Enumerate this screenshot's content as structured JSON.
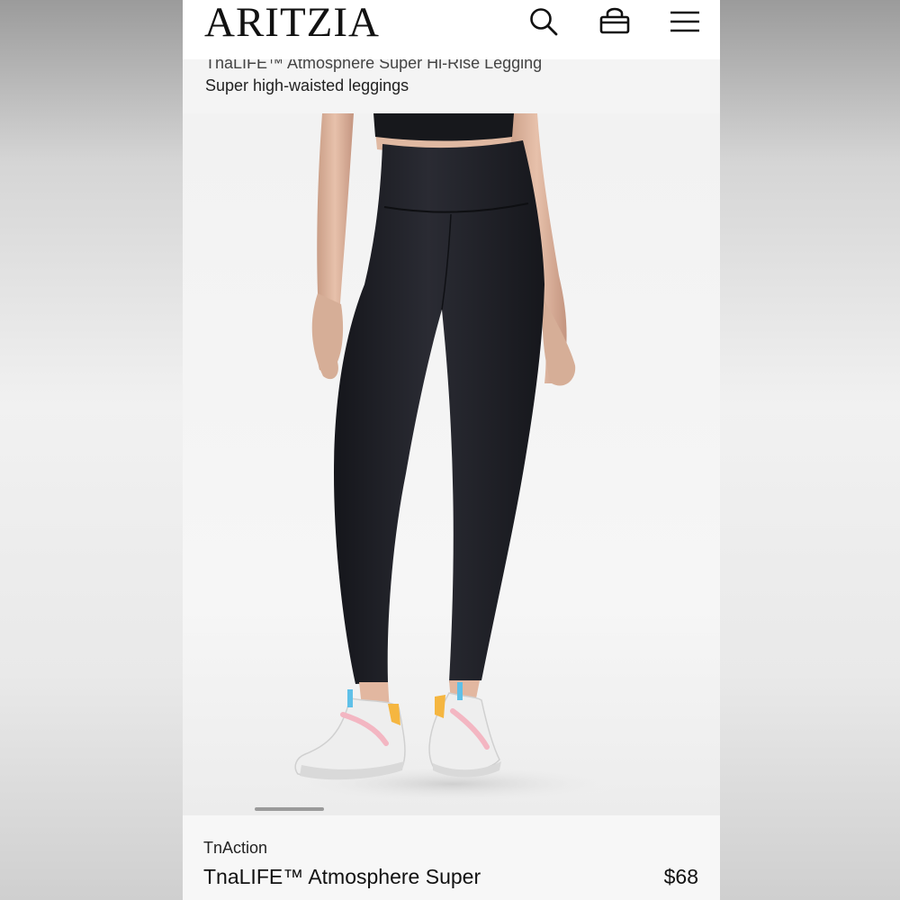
{
  "header": {
    "logo": "ARITZIA",
    "icons": [
      "search-icon",
      "bag-icon",
      "menu-icon"
    ]
  },
  "subheader": {
    "breadcrumb": "TnaLIFE™ Atmosphere Super Hi-Rise Legging",
    "tagline": "Super high-waisted leggings"
  },
  "product": {
    "brand": "TnAction",
    "name": "TnaLIFE™ Atmosphere Super",
    "price": "$68"
  },
  "colors": {
    "legging": "#1f2027",
    "background": "#f4f4f4"
  }
}
